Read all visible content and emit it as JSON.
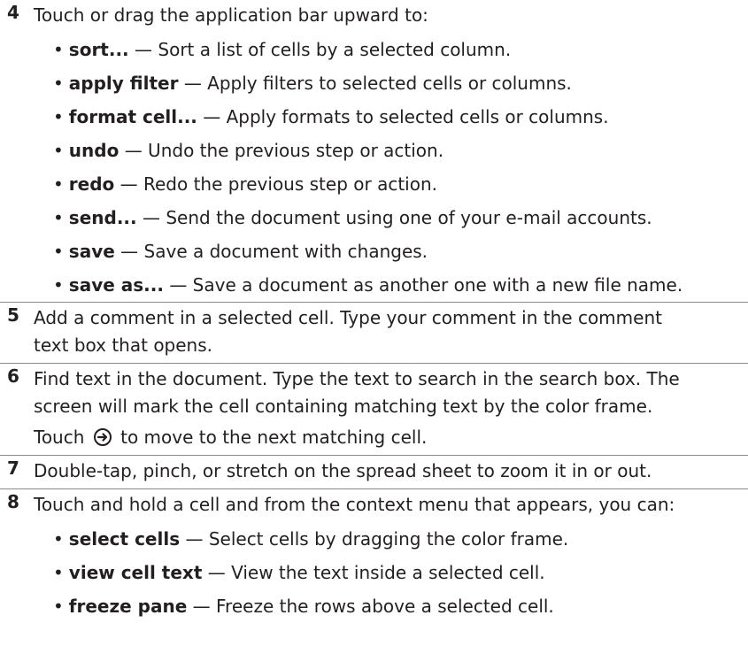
{
  "steps": [
    {
      "number": "4",
      "text": "Touch or drag the application bar upward to:",
      "items": [
        {
          "term": "sort...",
          "desc": "— Sort a list of cells by a selected column."
        },
        {
          "term": "apply filter",
          "desc": "— Apply filters to selected cells or columns."
        },
        {
          "term": "format cell...",
          "desc": "— Apply formats to selected cells or columns."
        },
        {
          "term": "undo",
          "desc": "— Undo the previous step or action."
        },
        {
          "term": "redo",
          "desc": "— Redo the previous step or action."
        },
        {
          "term": "send...",
          "desc": "— Send the document using one of your e-mail accounts."
        },
        {
          "term": "save",
          "desc": "— Save a document with changes."
        },
        {
          "term": "save as...",
          "desc": "— Save a document as another one with a new file name."
        }
      ]
    },
    {
      "number": "5",
      "line1": "Add a comment in a selected cell. Type your comment in the comment",
      "line2": "text box that opens."
    },
    {
      "number": "6",
      "line1": "Find text in the document. Type the text to search in the search box. The",
      "line2": "screen will mark the cell containing matching text by the color frame.",
      "line3_pre": "Touch",
      "line3_icon": "next-arrow-icon",
      "line3_post": "to move to the next matching cell."
    },
    {
      "number": "7",
      "text": "Double-tap, pinch, or stretch on the spread sheet to zoom it in or out."
    },
    {
      "number": "8",
      "text": "Touch and hold a cell and from the context menu that appears, you can:",
      "items": [
        {
          "term": "select cells",
          "desc": "— Select cells by dragging the color frame."
        },
        {
          "term": "view cell text",
          "desc": "— View the text inside a selected cell."
        },
        {
          "term": "freeze pane",
          "desc": "— Freeze the rows above a selected cell."
        }
      ]
    }
  ]
}
